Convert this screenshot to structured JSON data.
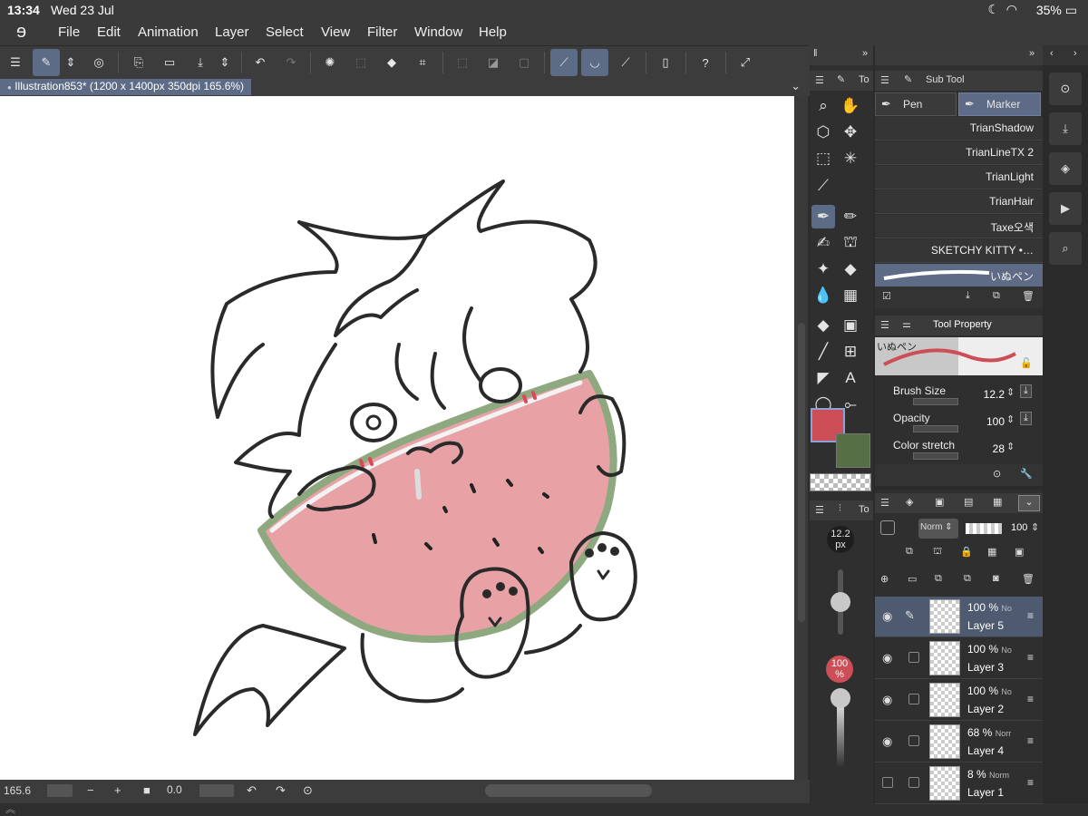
{
  "status": {
    "time": "13:34",
    "date": "Wed 23 Jul",
    "battery": "35%"
  },
  "menu": [
    "File",
    "Edit",
    "Animation",
    "Layer",
    "Select",
    "View",
    "Filter",
    "Window",
    "Help"
  ],
  "document": {
    "tab_label": "Illustration853* (1200 x 1400px 350dpi 165.6%)"
  },
  "panels": {
    "tool_tab": "To",
    "subtool_title": "Sub Tool",
    "subtool_tabs": [
      "Pen",
      "Marker"
    ],
    "brushes": [
      "TrianShadow",
      "TrianLineTX 2",
      "TrianLight",
      "TrianHair",
      "Taxe오색",
      "SKETCHY KITTY •…",
      "いぬペン"
    ],
    "tool_property_title": "Tool Property",
    "preview_label": "いぬペン",
    "properties": [
      {
        "label": "Brush Size",
        "value": "12.2"
      },
      {
        "label": "Opacity",
        "value": "100"
      },
      {
        "label": "Color stretch",
        "value": "28"
      }
    ]
  },
  "size_panel": {
    "tab": "To",
    "size_value": "12.2",
    "size_unit": "px",
    "opacity_value": "100",
    "opacity_unit": "%"
  },
  "layer_panel": {
    "blend_mode": "Norm",
    "opacity": "100",
    "layers": [
      {
        "opacity": "100 %",
        "mode": "No",
        "name": "Layer 5",
        "selected": true
      },
      {
        "opacity": "100 %",
        "mode": "No",
        "name": "Layer 3",
        "selected": false
      },
      {
        "opacity": "100 %",
        "mode": "No",
        "name": "Layer 2",
        "selected": false
      },
      {
        "opacity": "68 %",
        "mode": "Norr",
        "name": "Layer 4",
        "selected": false
      },
      {
        "opacity": "8 %",
        "mode": "Norm",
        "name": "Layer 1",
        "selected": false
      }
    ]
  },
  "bottom": {
    "zoom": "165.6",
    "rotation": "0.0"
  },
  "colors": {
    "main": "#cc4e56",
    "sub": "#566f43",
    "accent": "#5c6c86"
  }
}
